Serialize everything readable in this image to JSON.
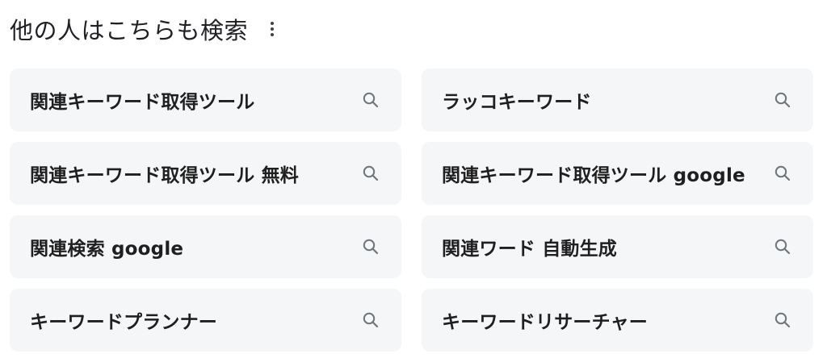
{
  "header": {
    "title": "他の人はこちらも検索",
    "more_icon": "vertical-ellipsis-icon"
  },
  "suggestions": [
    {
      "label": "関連キーワード取得ツール",
      "icon": "search-icon"
    },
    {
      "label": "ラッコキーワード",
      "icon": "search-icon"
    },
    {
      "label": "関連キーワード取得ツール 無料",
      "icon": "search-icon"
    },
    {
      "label": "関連キーワード取得ツール google",
      "icon": "search-icon"
    },
    {
      "label": "関連検索 google",
      "icon": "search-icon"
    },
    {
      "label": "関連ワード 自動生成",
      "icon": "search-icon"
    },
    {
      "label": "キーワードプランナー",
      "icon": "search-icon"
    },
    {
      "label": "キーワードリサーチャー",
      "icon": "search-icon"
    }
  ],
  "colors": {
    "chip_background": "#f5f6f8",
    "text": "#1f1f1f",
    "icon": "#70757a"
  }
}
